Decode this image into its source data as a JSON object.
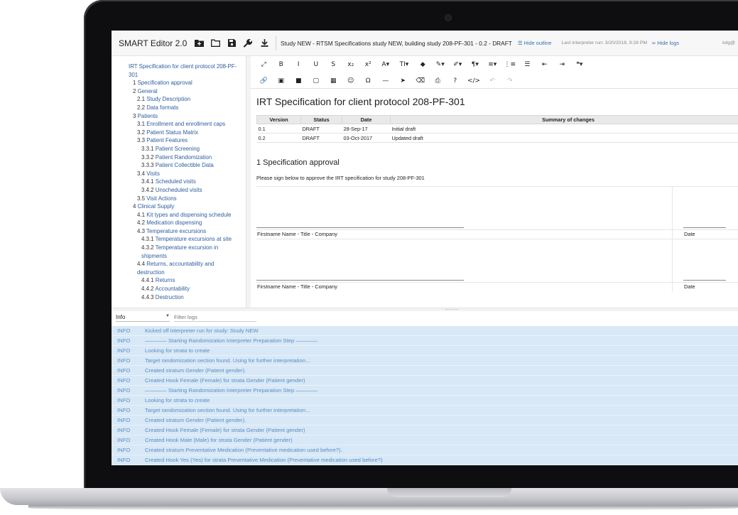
{
  "app": {
    "title": "SMART Editor 2.0",
    "study_title": "Study NEW - RTSM Specifications study NEW, building study 208-PF-301 - 0.2 - DRAFT",
    "hide_outline": "Hide outline",
    "last_run": "Last interpreter run: 3/20/2018, 9:28 PM",
    "hide_logs": "Hide logs",
    "user": "kdg@"
  },
  "header_icons": [
    "add-folder-icon",
    "folder-icon",
    "save-icon",
    "wrench-icon",
    "download-icon"
  ],
  "outline": [
    {
      "num": "",
      "label": "IRT Specification for client protocol 208-PF-",
      "level": 0
    },
    {
      "num": "",
      "label": "301",
      "level": 0,
      "cont": true
    },
    {
      "num": "1",
      "label": "Specification approval",
      "level": 1
    },
    {
      "num": "2",
      "label": "General",
      "level": 1
    },
    {
      "num": "2.1",
      "label": "Study Description",
      "level": 2
    },
    {
      "num": "2.2",
      "label": "Data formats",
      "level": 2
    },
    {
      "num": "3",
      "label": "Patients",
      "level": 1
    },
    {
      "num": "3.1",
      "label": "Enrollment and enrollment caps",
      "level": 2
    },
    {
      "num": "3.2",
      "label": "Patient Status Matrix",
      "level": 2
    },
    {
      "num": "3.3",
      "label": "Patient Features",
      "level": 2
    },
    {
      "num": "3.3.1",
      "label": "Patient Screening",
      "level": 3
    },
    {
      "num": "3.3.2",
      "label": "Patient Randomization",
      "level": 3
    },
    {
      "num": "3.3.3",
      "label": "Patient Collectible Data",
      "level": 3
    },
    {
      "num": "3.4",
      "label": "Visits",
      "level": 2
    },
    {
      "num": "3.4.1",
      "label": "Scheduled visits",
      "level": 3
    },
    {
      "num": "3.4.2",
      "label": "Unscheduled visits",
      "level": 3
    },
    {
      "num": "3.5",
      "label": "Visit Actions",
      "level": 2
    },
    {
      "num": "4",
      "label": "Clinical Supply",
      "level": 1
    },
    {
      "num": "4.1",
      "label": "Kit types and dispensing schedule",
      "level": 2
    },
    {
      "num": "4.2",
      "label": "Medication dispensing",
      "level": 2
    },
    {
      "num": "4.3",
      "label": "Temperature excursions",
      "level": 2
    },
    {
      "num": "4.3.1",
      "label": "Temperature excursions at site",
      "level": 3
    },
    {
      "num": "4.3.2",
      "label": "Temperature excursion in",
      "level": 3
    },
    {
      "num": "",
      "label": "shipments",
      "level": 3,
      "cont": true
    },
    {
      "num": "4.4",
      "label": "Returns, accountability and",
      "level": 2
    },
    {
      "num": "",
      "label": "destruction",
      "level": 2,
      "cont": true
    },
    {
      "num": "4.4.1",
      "label": "Returns",
      "level": 3
    },
    {
      "num": "4.4.2",
      "label": "Accountability",
      "level": 3
    },
    {
      "num": "4.4.3",
      "label": "Destruction",
      "level": 3
    }
  ],
  "toolbar": {
    "row1": [
      "⤢",
      "B",
      "I",
      "U",
      "S",
      "x₂",
      "x²",
      "A▾",
      "TI▾",
      "◆",
      "✎▾",
      "✐▾",
      "¶▾",
      "≡▾",
      "⋮≡",
      "☰",
      "⇤",
      "⇥",
      "❝▾"
    ],
    "row2": [
      "🔗",
      "▣",
      "■",
      "▢",
      "▦",
      "☺",
      "Ω",
      "—",
      "➤",
      "⌫",
      "⎙",
      "?",
      "</>",
      "↶",
      "↷"
    ]
  },
  "document": {
    "title": "IRT Specification for client protocol 208-PF-301",
    "version_table": {
      "headers": [
        "Version",
        "Status",
        "Date",
        "Summary of changes"
      ],
      "rows": [
        [
          "0.1",
          "DRAFT",
          "28-Sep-17",
          "Initial draft"
        ],
        [
          "0.2",
          "DRAFT",
          "03-Oct-2017",
          "Updated draft"
        ]
      ]
    },
    "section1_heading": "1 Specification approval",
    "section1_text": "Please sign below to approve the IRT specification for study 208-PF-301",
    "signatures": [
      {
        "name": "Firstname Name - Title - Company",
        "date": "Date"
      },
      {
        "name": "Firstname Name - Title - Company",
        "date": "Date"
      }
    ]
  },
  "logs_panel": {
    "level": "Info",
    "filter_placeholder": "Filter logs",
    "entries": [
      {
        "level": "INFO",
        "message": "Kicked off interpreter run for study: Study NEW"
      },
      {
        "level": "INFO",
        "message": "———— Starting Randomization Interpreter Preparation Step ————"
      },
      {
        "level": "INFO",
        "message": "Looking for strata to create"
      },
      {
        "level": "INFO",
        "message": "Target randomization section found. Using for further interpretation..."
      },
      {
        "level": "INFO",
        "message": "Created stratum Gender (Patient gender)."
      },
      {
        "level": "INFO",
        "message": "Created Hook Female (Female) for strata Gender (Patient gender)"
      },
      {
        "level": "INFO",
        "message": "———— Starting Randomization Interpreter Preparation Step ————"
      },
      {
        "level": "INFO",
        "message": "Looking for strata to create"
      },
      {
        "level": "INFO",
        "message": "Target randomization section found. Using for further interpretation..."
      },
      {
        "level": "INFO",
        "message": "Created stratum Gender (Patient gender)."
      },
      {
        "level": "INFO",
        "message": "Created Hook Female (Female) for strata Gender (Patient gender)"
      },
      {
        "level": "INFO",
        "message": "Created Hook Male (Male) for strata Gender (Patient gender)"
      },
      {
        "level": "INFO",
        "message": "Created stratum Preventative Medication (Preventative medication used before?)."
      },
      {
        "level": "INFO",
        "message": "Created Hook Yes (Yes) for strata Preventative Medication (Preventative medication used before?)"
      }
    ]
  }
}
